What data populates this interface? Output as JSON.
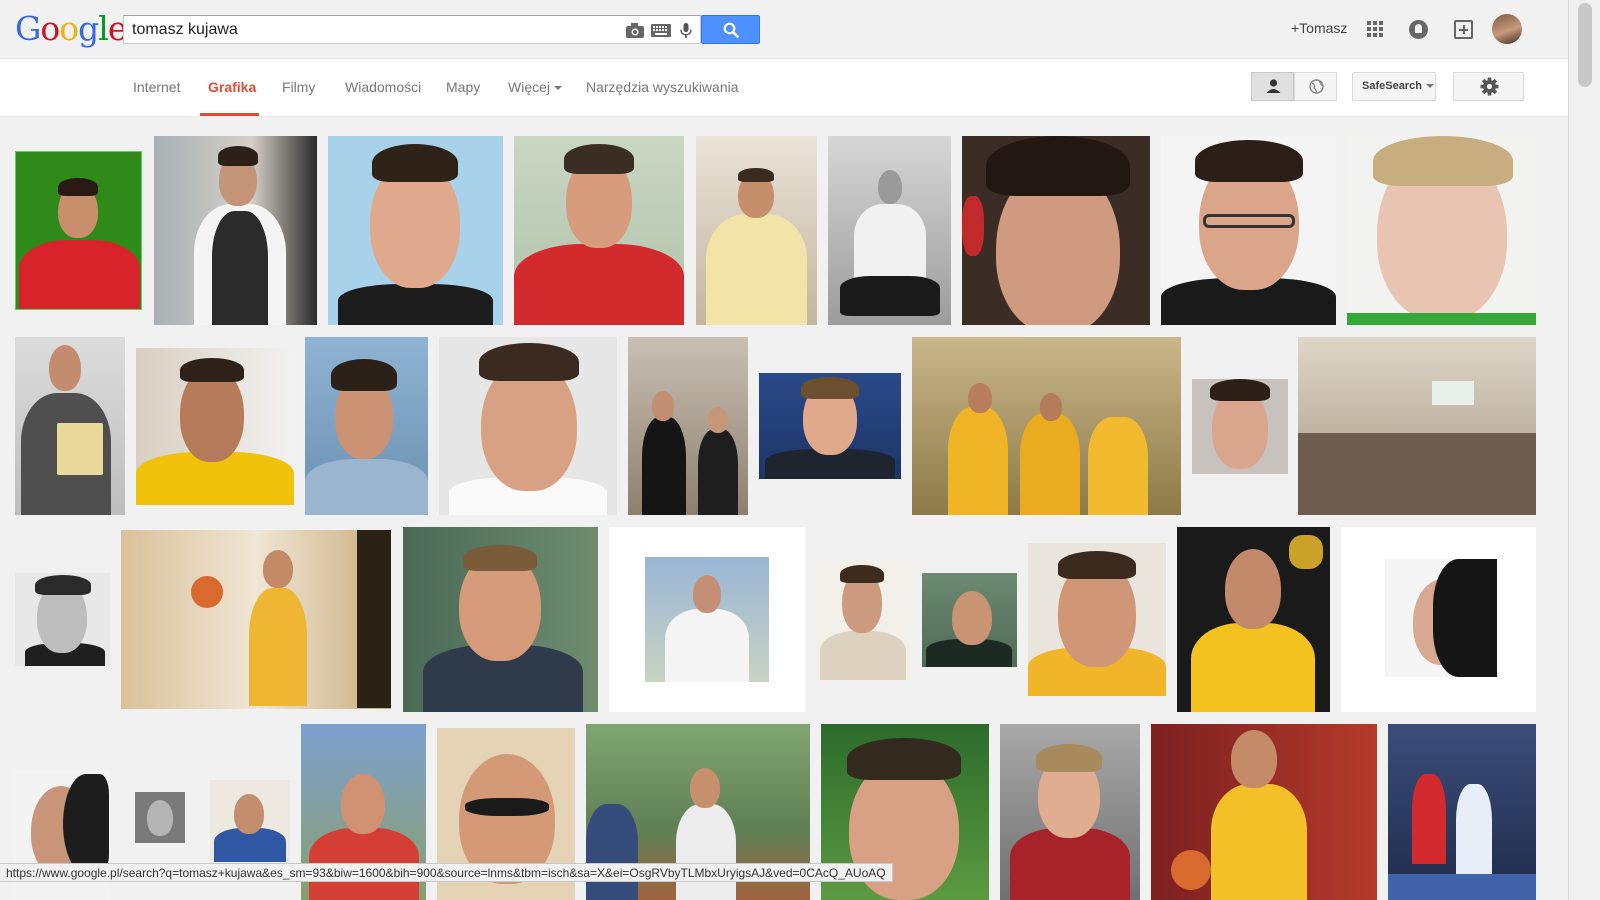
{
  "logo": {
    "letters": [
      "G",
      "o",
      "o",
      "g",
      "l",
      "e"
    ],
    "colors": [
      "#3369e8",
      "#d50f25",
      "#eeb211",
      "#3369e8",
      "#009925",
      "#d50f25"
    ]
  },
  "search": {
    "query": "tomasz kujawa",
    "button_icon": "search-icon"
  },
  "header": {
    "user_label": "+Tomasz",
    "icons": [
      "apps-icon",
      "notifications-icon",
      "share-icon"
    ]
  },
  "nav": {
    "tabs": [
      {
        "label": "Internet",
        "active": false
      },
      {
        "label": "Grafika",
        "active": true
      },
      {
        "label": "Filmy",
        "active": false
      },
      {
        "label": "Wiadomości",
        "active": false
      },
      {
        "label": "Mapy",
        "active": false
      },
      {
        "label": "Więcej",
        "active": false
      },
      {
        "label": "Narzędzia wyszukiwania",
        "active": false
      }
    ],
    "safesearch_label": "SafeSearch",
    "accent": "#dd4b39"
  },
  "status_url": "https://www.google.pl/search?q=tomasz+kujawa&es_sm=93&biw=1600&bih=900&source=lnms&tbm=isch&sa=X&ei=OsgRVbyTLMbxUryigsAJ&ved=0CAcQ_AUoAQ"
}
